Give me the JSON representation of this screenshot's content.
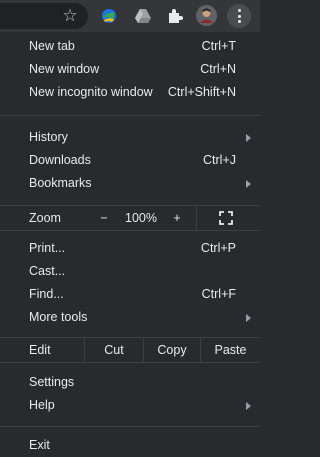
{
  "toolbar": {
    "icons": [
      "star-icon",
      "google-earth-extension-icon",
      "google-drive-extension-icon",
      "extensions-puzzle-icon",
      "profile-avatar",
      "more-menu-icon"
    ]
  },
  "menu": {
    "group1": [
      {
        "label": "New tab",
        "shortcut": "Ctrl+T"
      },
      {
        "label": "New window",
        "shortcut": "Ctrl+N"
      },
      {
        "label": "New incognito window",
        "shortcut": "Ctrl+Shift+N"
      }
    ],
    "group2": [
      {
        "label": "History",
        "shortcut": ""
      },
      {
        "label": "Downloads",
        "shortcut": "Ctrl+J"
      },
      {
        "label": "Bookmarks",
        "shortcut": ""
      }
    ],
    "zoom": {
      "label": "Zoom",
      "minus": "−",
      "value": "100%",
      "plus": "+"
    },
    "group3": [
      {
        "label": "Print...",
        "shortcut": "Ctrl+P"
      },
      {
        "label": "Cast...",
        "shortcut": ""
      },
      {
        "label": "Find...",
        "shortcut": "Ctrl+F"
      },
      {
        "label": "More tools",
        "shortcut": ""
      }
    ],
    "edit": {
      "label": "Edit",
      "cut": "Cut",
      "copy": "Copy",
      "paste": "Paste"
    },
    "group4": [
      {
        "label": "Settings"
      },
      {
        "label": "Help"
      }
    ],
    "exit": {
      "label": "Exit"
    }
  },
  "colors": {
    "menu_bg": "#292a2d",
    "toolbar_bg": "#35363a",
    "text": "#e8eaed",
    "separator": "#3c4043"
  }
}
